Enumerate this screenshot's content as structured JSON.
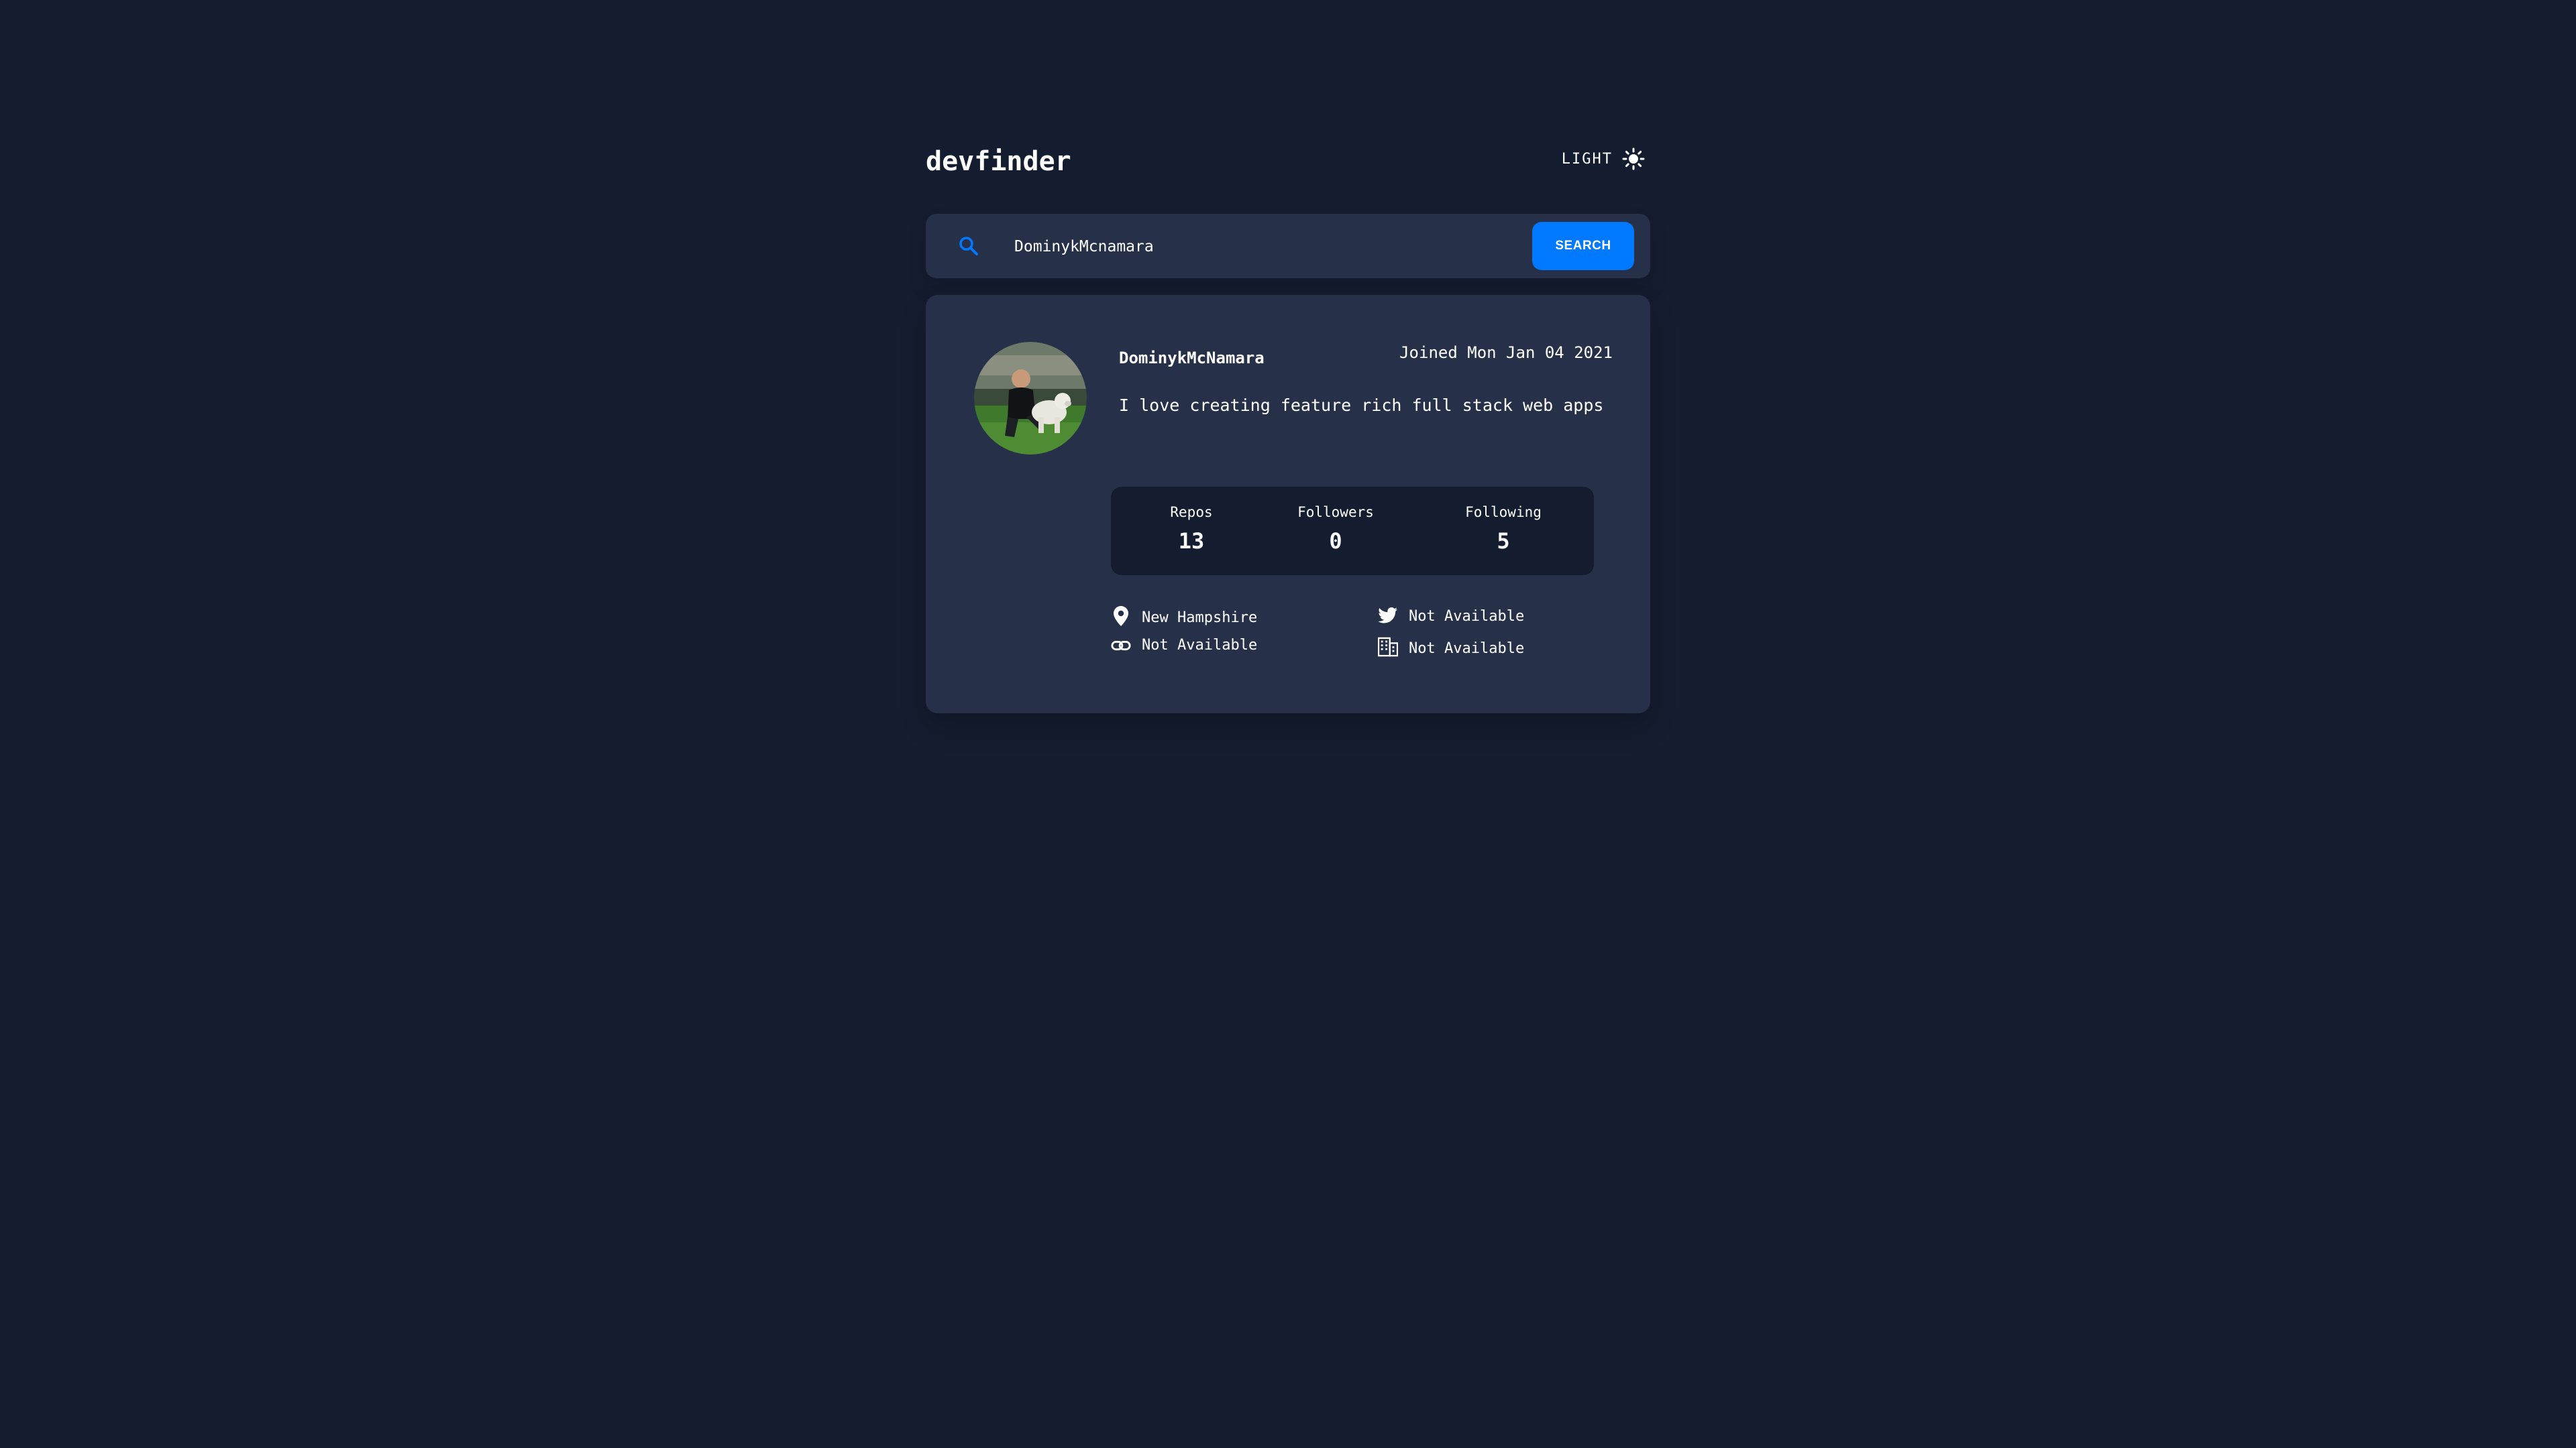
{
  "header": {
    "logo": "devfinder",
    "theme_label": "LIGHT",
    "theme_icon": "sun-icon"
  },
  "search": {
    "value": "DominykMcnamara",
    "button_label": "SEARCH",
    "icon": "search-icon"
  },
  "profile": {
    "username": "DominykMcNamara",
    "joined": "Joined Mon Jan 04 2021",
    "bio": "I love creating feature rich full stack web apps",
    "stats": {
      "repos_label": "Repos",
      "repos_value": "13",
      "followers_label": "Followers",
      "followers_value": "0",
      "following_label": "Following",
      "following_value": "5"
    },
    "links": {
      "location": "New Hampshire",
      "blog": "Not Available",
      "twitter": "Not Available",
      "company": "Not Available"
    }
  },
  "colors": {
    "background": "#141c2f",
    "card": "#263049",
    "accent": "#0079ff",
    "text": "#ffffff"
  }
}
